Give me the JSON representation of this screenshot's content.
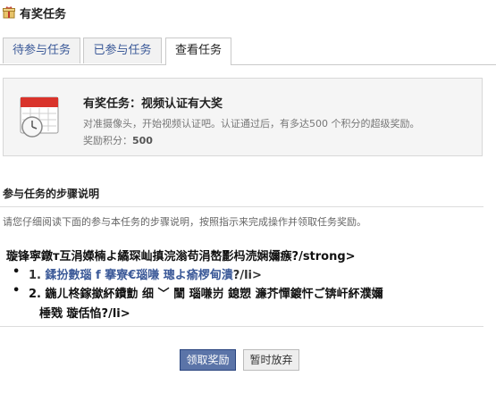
{
  "header": {
    "title": "有奖任务",
    "icon": "gift-task-icon"
  },
  "tabs": [
    {
      "label": "待参与任务",
      "active": false
    },
    {
      "label": "已参与任务",
      "active": false
    },
    {
      "label": "查看任务",
      "active": true
    }
  ],
  "task": {
    "icon": "calendar-icon",
    "title": "有奖任务：视频认证有大奖",
    "description": "对准摄像头，开始视频认证吧。认证通过后，有多达500 个积分的超级奖励。",
    "points_label": "奖励积分：",
    "points_value": "500"
  },
  "steps": {
    "title": "参与任务的步骤说明",
    "description": "请您仔细阅读下面的参与本任务的步骤说明，按照指示来完成操作并领取任务奖励。",
    "garbled_heading": "璇锋寜鐓т互涓嬫楠よ繘琛屾搷浣滃苟涓嶅彲杩涜娴嬭瘯?/strong>",
    "item1_prefix": "1. ",
    "item1_link": "鍒扮數瑙 f 搴寮€瑙嗛   璁よ瘉椤甸潰",
    "item1_suffix": "?/li>",
    "item2_line1": "2. 鍦ㄦ柊鎵撳紑鐨勯   细   ﹀   闉   瑙嗛岃   鎴愬   濂芥憚鍍忓ご锛屽紑濮嬭",
    "item2_line2": "棰戣   璇佸惂?/li>"
  },
  "actions": {
    "claim_label": "领取奖励",
    "abandon_label": "暂时放弃"
  }
}
